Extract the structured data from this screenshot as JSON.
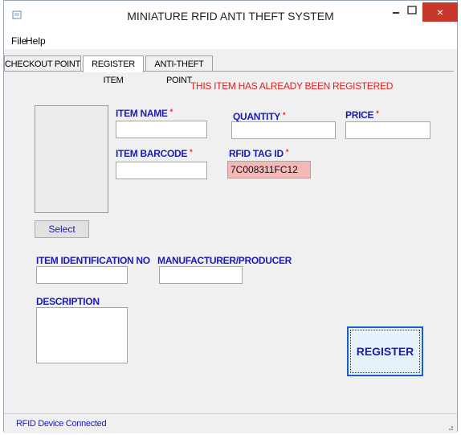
{
  "window": {
    "title": "MINIATURE RFID ANTI THEFT SYSTEM",
    "close_label": "×"
  },
  "menu": {
    "file": "File",
    "help": "Help"
  },
  "tabs": [
    {
      "label": "CHECKOUT POINT",
      "active": false
    },
    {
      "label": "REGISTER ITEM",
      "active": true
    },
    {
      "label": "ANTI-THEFT POINT",
      "active": false
    }
  ],
  "form": {
    "alert": "THIS ITEM HAS ALREADY BEEN REGISTERED",
    "required_mark": "*",
    "select_button": "Select",
    "item_name": {
      "label": "ITEM NAME",
      "value": ""
    },
    "quantity": {
      "label": "QUANTITY",
      "value": ""
    },
    "price": {
      "label": "PRICE",
      "value": ""
    },
    "item_barcode": {
      "label": "ITEM BARCODE",
      "value": ""
    },
    "rfid_tag_id": {
      "label": "RFID TAG ID",
      "value": "7C008311FC12"
    },
    "item_identification_no": {
      "label": "ITEM IDENTIFICATION NO",
      "value": ""
    },
    "manufacturer": {
      "label": "MANUFACTURER/PRODUCER",
      "value": ""
    },
    "description": {
      "label": "DESCRIPTION",
      "value": ""
    },
    "register_button": "REGISTER"
  },
  "status": {
    "text": "RFID Device Connected"
  },
  "colors": {
    "label_blue": "#1b1bb8",
    "alert_red": "#e02020",
    "tag_field_pink": "#f6b7b7",
    "close_red": "#c7382b"
  },
  "icons": {
    "app": "app-icon",
    "minimize": "minimize-icon",
    "maximize": "maximize-icon",
    "close": "close-icon",
    "grip": "resize-grip-icon"
  }
}
